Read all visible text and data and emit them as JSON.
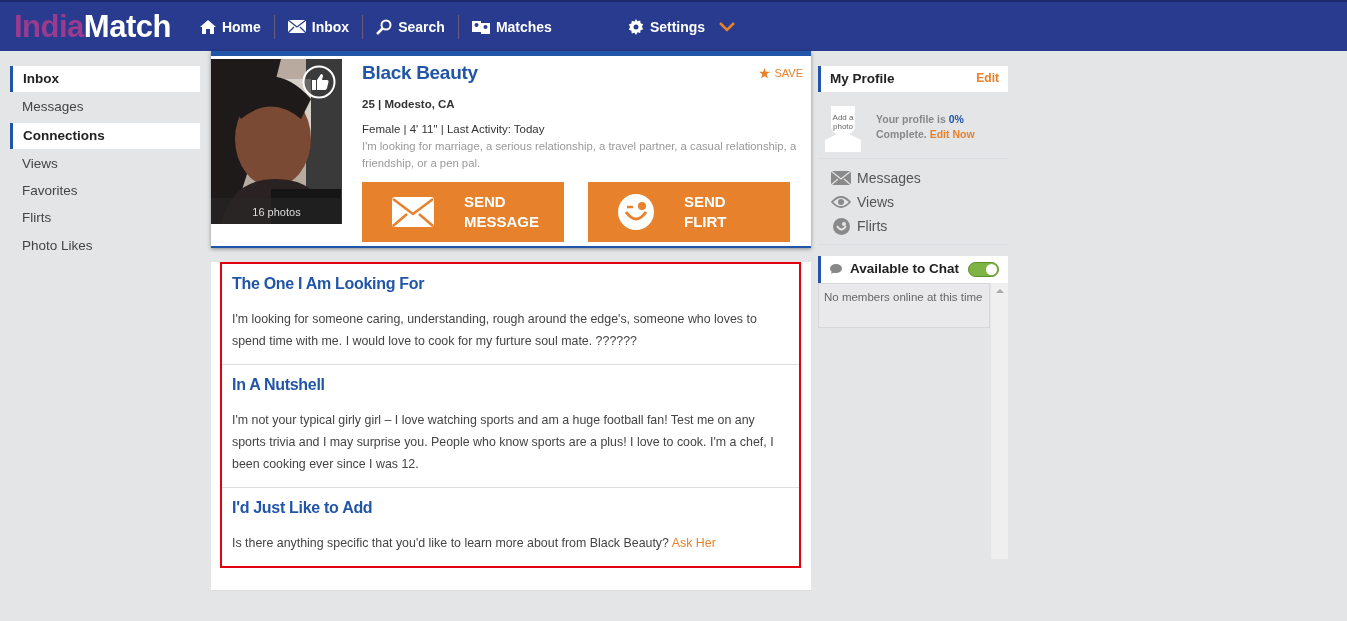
{
  "brand": {
    "part1": "India",
    "part2": "Match"
  },
  "nav": [
    {
      "kind": "home",
      "label": "Home"
    },
    {
      "kind": "inbox",
      "label": "Inbox"
    },
    {
      "kind": "search",
      "label": "Search"
    },
    {
      "kind": "matches",
      "label": "Matches"
    },
    {
      "kind": "settings",
      "label": "Settings",
      "dropdown": true
    }
  ],
  "sidebar": [
    {
      "kind": "header",
      "label": "Inbox"
    },
    {
      "kind": "item",
      "label": "Messages"
    },
    {
      "kind": "header",
      "label": "Connections"
    },
    {
      "kind": "item",
      "label": "Views"
    },
    {
      "kind": "item",
      "label": "Favorites"
    },
    {
      "kind": "item",
      "label": "Flirts"
    },
    {
      "kind": "item",
      "label": "Photo Likes"
    }
  ],
  "profile": {
    "photo_count": "16 photos",
    "name": "Black Beauty",
    "save": "SAVE",
    "age_location": "25 | Modesto, CA",
    "details": "Female | 4' 11\" | Last Activity: Today",
    "looking_for": "I'm looking for marriage, a serious relationship, a travel partner, a casual relationship, a friendship, or a pen pal.",
    "buttons": [
      {
        "kind": "message",
        "line1": "SEND",
        "line2": "MESSAGE"
      },
      {
        "kind": "flirt",
        "line1": "SEND",
        "line2": "FLIRT"
      }
    ]
  },
  "sections": [
    {
      "title": "The One I Am Looking For",
      "text": "I'm looking for someone caring, understanding, rough around the edge's, someone who loves to spend time with me. I would love to cook for my furture soul mate. ??????"
    },
    {
      "title": "In A Nutshell",
      "text": "I'm not your typical girly girl – I love watching sports and am a huge football fan! Test me on any sports trivia and I may surprise you. People who know sports are a plus! I love to cook. I'm a chef, I been cooking ever since I was 12."
    },
    {
      "title": "I'd Just Like to Add",
      "text": "Is there anything specific that you'd like to learn more about from Black Beauty?",
      "link": "Ask Her"
    }
  ],
  "my_profile": {
    "title": "My Profile",
    "edit": "Edit",
    "avatar_text": "Add a photo",
    "status_prefix": "Your profile is",
    "percent": "0%",
    "status_suffix": "Complete.",
    "edit_now": "Edit Now",
    "links": [
      {
        "kind": "messages",
        "label": "Messages"
      },
      {
        "kind": "views",
        "label": "Views"
      },
      {
        "kind": "flirts",
        "label": "Flirts"
      }
    ]
  },
  "chat": {
    "title": "Available to Chat",
    "on": true,
    "empty": "No members online at this time"
  }
}
